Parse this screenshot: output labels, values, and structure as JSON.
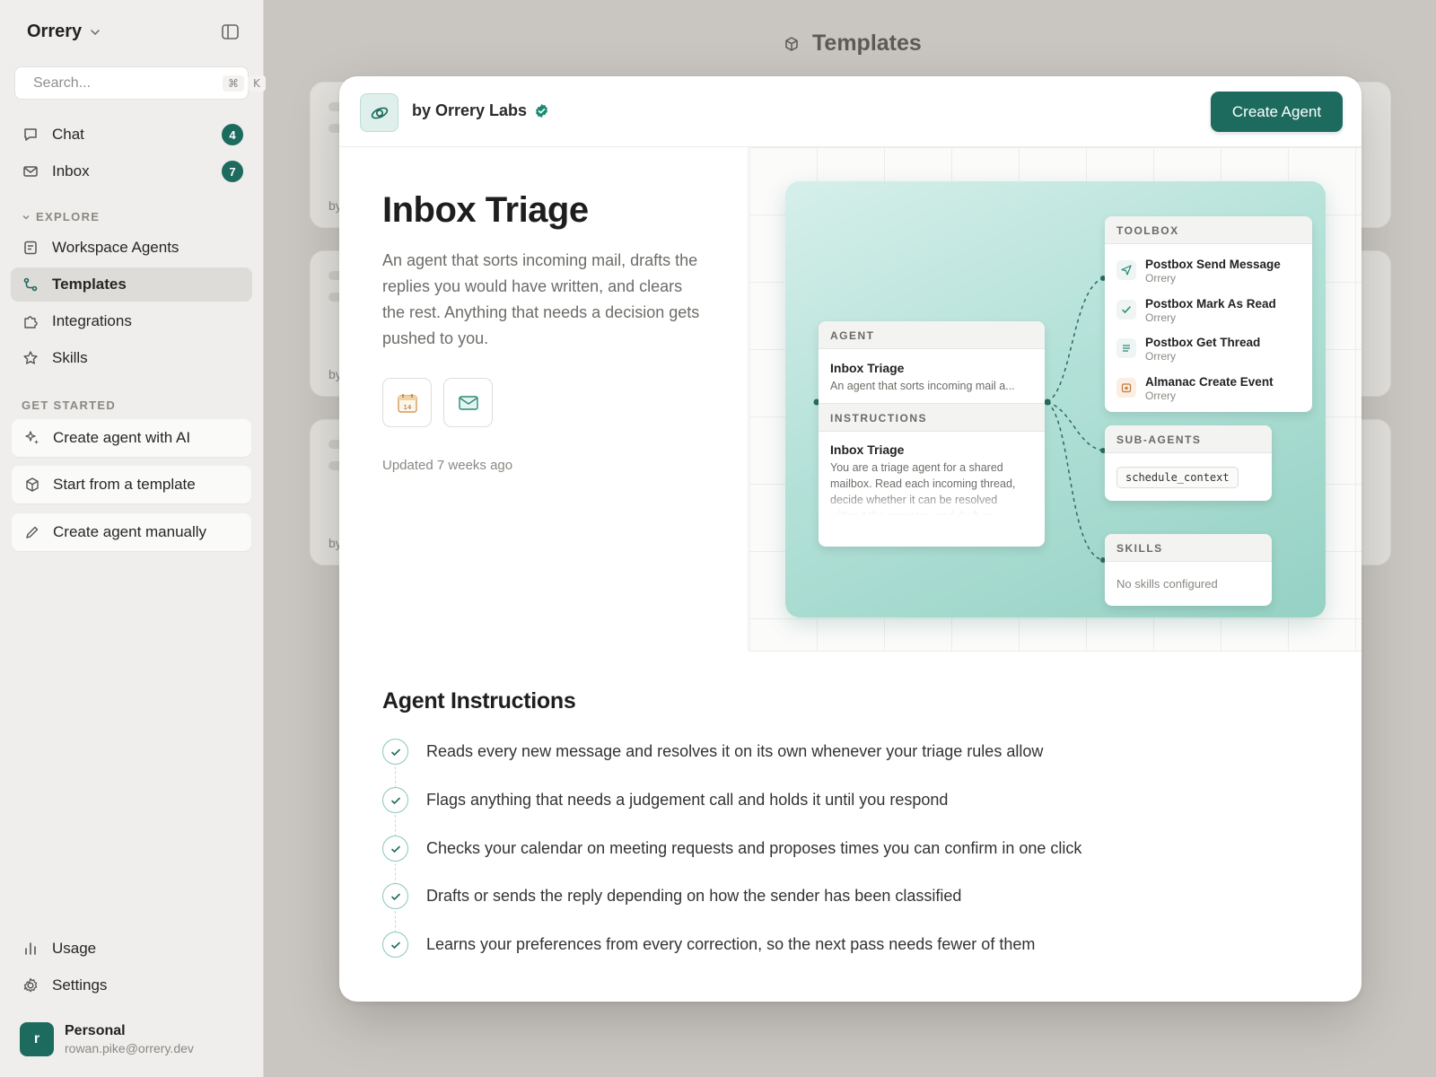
{
  "sidebar": {
    "workspace": "Orrery",
    "search": {
      "placeholder": "Search...",
      "shortcut_cmd": "⌘",
      "shortcut_key": "K"
    },
    "nav": [
      {
        "label": "Chat",
        "badge": "4",
        "icon": "chat-bubble-icon"
      },
      {
        "label": "Inbox",
        "badge": "7",
        "icon": "mail-icon"
      }
    ],
    "explore_label": "EXPLORE",
    "explore_items": [
      {
        "label": "Workspace Agents",
        "icon": "agent-list-icon"
      },
      {
        "label": "Templates",
        "icon": "templates-icon",
        "active": true
      },
      {
        "label": "Integrations",
        "icon": "puzzle-icon"
      },
      {
        "label": "Skills",
        "icon": "star-icon"
      }
    ],
    "get_started_label": "GET STARTED",
    "get_started_items": [
      {
        "label": "Create agent with AI",
        "icon": "sparkles-icon"
      },
      {
        "label": "Start from a template",
        "icon": "cube-icon"
      },
      {
        "label": "Create agent manually",
        "icon": "pencil-icon"
      }
    ],
    "bottom": [
      {
        "label": "Usage",
        "icon": "bar-chart-icon"
      },
      {
        "label": "Settings",
        "icon": "gear-icon"
      }
    ],
    "user": {
      "initial": "r",
      "name": "Personal",
      "email": "rowan.pike@orrery.dev"
    }
  },
  "main": {
    "title": "Templates",
    "bg_card_by": "by"
  },
  "modal": {
    "author": "by Orrery Labs",
    "create_button": "Create Agent",
    "agent_name": "Inbox Triage",
    "description": "An agent that sorts incoming mail, drafts the replies you would have written, and clears the rest. Anything that needs a decision gets pushed to you.",
    "calendar_day": "14",
    "updated": "Updated 7 weeks ago",
    "diagram": {
      "agent_header": "AGENT",
      "agent_name": "Inbox Triage",
      "agent_summary": "An agent that sorts incoming mail a...",
      "instructions_header": "INSTRUCTIONS",
      "instructions_name": "Inbox Triage",
      "instructions_text": "You are a triage agent for a shared mailbox. Read each incoming thread, decide whether it can be resolved without the operator, and draft or",
      "toolbox_header": "TOOLBOX",
      "tools": [
        {
          "name": "Postbox Send Message",
          "source": "Orrery",
          "icon": "send-icon"
        },
        {
          "name": "Postbox Mark As Read",
          "source": "Orrery",
          "icon": "check-icon"
        },
        {
          "name": "Postbox Get Thread",
          "source": "Orrery",
          "icon": "lines-icon"
        },
        {
          "name": "Almanac Create Event",
          "source": "Orrery",
          "icon": "calendar-icon"
        }
      ],
      "subagents_header": "SUB-AGENTS",
      "subagent": "schedule_context",
      "skills_header": "SKILLS",
      "skills_empty": "No skills configured"
    },
    "instructions_title": "Agent Instructions",
    "steps": [
      "Reads every new message and resolves it on its own whenever your triage rules allow",
      "Flags anything that needs a judgement call and holds it until you respond",
      "Checks your calendar on meeting requests and proposes times you can confirm in one click",
      "Drafts or sends the reply depending on how the sender has been classified",
      "Learns your preferences from every correction, so the next pass needs fewer of them"
    ]
  },
  "colors": {
    "accent": "#1c6b5e",
    "canvas": "#a9dcd1"
  }
}
